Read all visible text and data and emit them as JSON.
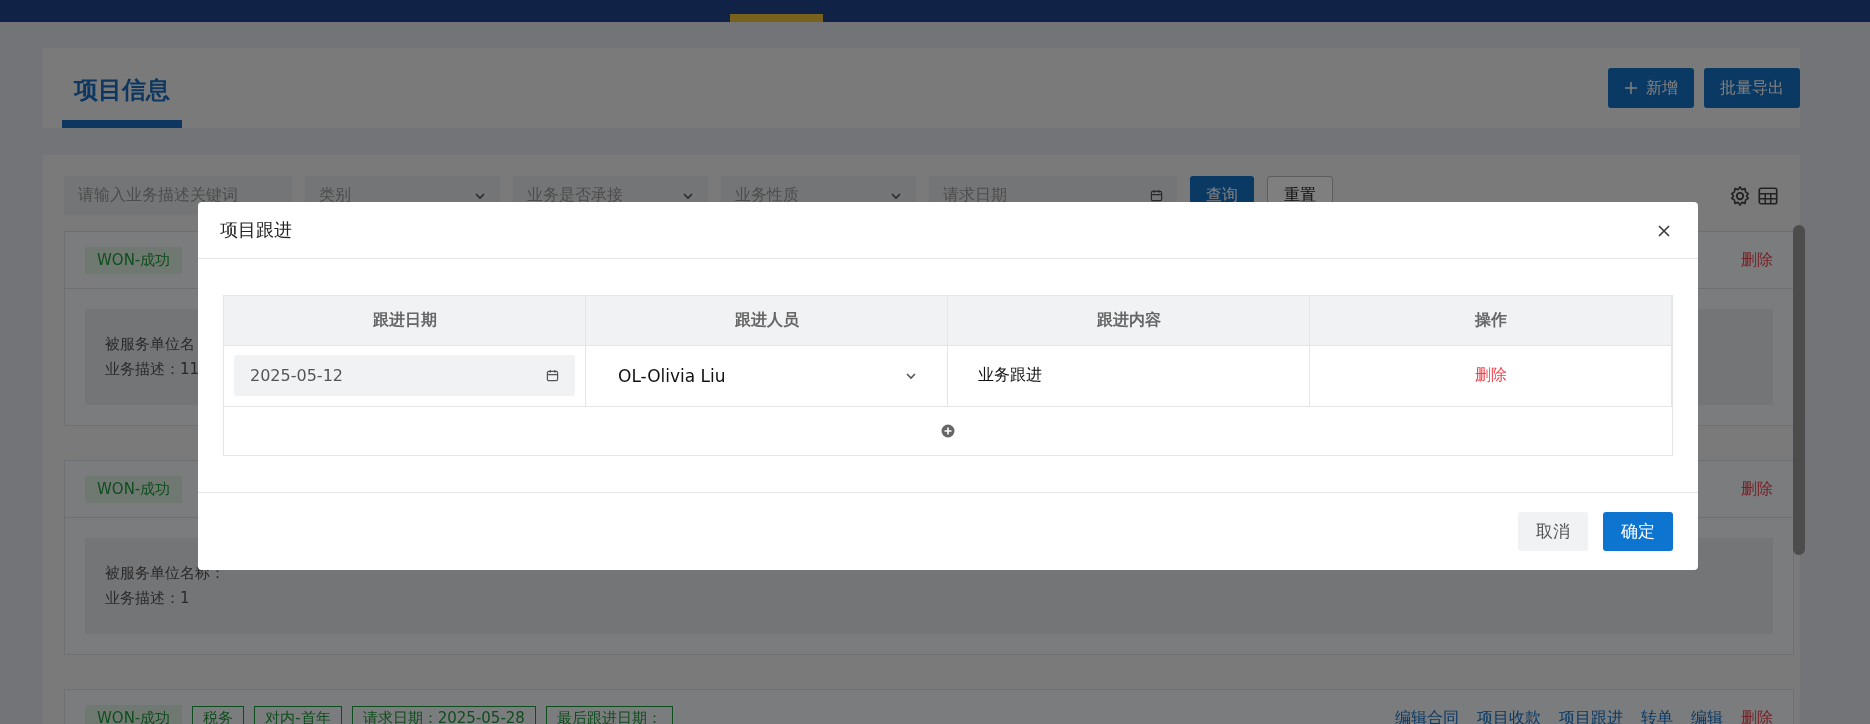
{
  "header": {
    "title": "项目信息",
    "buttons": [
      {
        "label": "新增",
        "kind": "add"
      },
      {
        "label": "批量导出",
        "kind": "plain"
      }
    ]
  },
  "filters": {
    "fields": [
      {
        "kind": "input",
        "placeholder": "请输入业务描述关键词"
      },
      {
        "kind": "select",
        "placeholder": "类别"
      },
      {
        "kind": "select",
        "placeholder": "业务是否承接"
      },
      {
        "kind": "select",
        "placeholder": "业务性质"
      },
      {
        "kind": "date",
        "placeholder": "请求日期"
      }
    ],
    "buttons": [
      {
        "label": "查询",
        "kind": "primary"
      },
      {
        "label": "重置",
        "kind": "default"
      }
    ]
  },
  "cards": [
    {
      "status": "WON-成功",
      "actions": [
        {
          "label": "删除",
          "kind": "danger"
        }
      ],
      "client": "被服务单位名",
      "description": "业务描述：11"
    },
    {
      "status": "WON-成功",
      "actions": [
        {
          "label": "删除",
          "kind": "danger"
        }
      ],
      "client": "被服务单位名称：",
      "description": "业务描述：1"
    },
    {
      "status": "WON-成功",
      "tags": [
        "税务",
        "对内-首年",
        "请求日期：2025-05-28",
        "最后跟进日期："
      ],
      "actions": [
        {
          "label": "编辑合同",
          "kind": "link"
        },
        {
          "label": "项目收款",
          "kind": "link"
        },
        {
          "label": "项目跟进",
          "kind": "link"
        },
        {
          "label": "转单",
          "kind": "link"
        },
        {
          "label": "编辑",
          "kind": "link"
        },
        {
          "label": "删除",
          "kind": "danger"
        }
      ]
    }
  ],
  "modal": {
    "title": "项目跟进",
    "columns": [
      "跟进日期",
      "跟进人员",
      "跟进内容",
      "操作"
    ],
    "rows": [
      {
        "date": "2025-05-12",
        "person": "OL-Olivia Liu",
        "content": "业务跟进",
        "action": "删除"
      }
    ],
    "buttons": [
      {
        "label": "取消",
        "kind": "default"
      },
      {
        "label": "确定",
        "kind": "primary"
      }
    ]
  }
}
